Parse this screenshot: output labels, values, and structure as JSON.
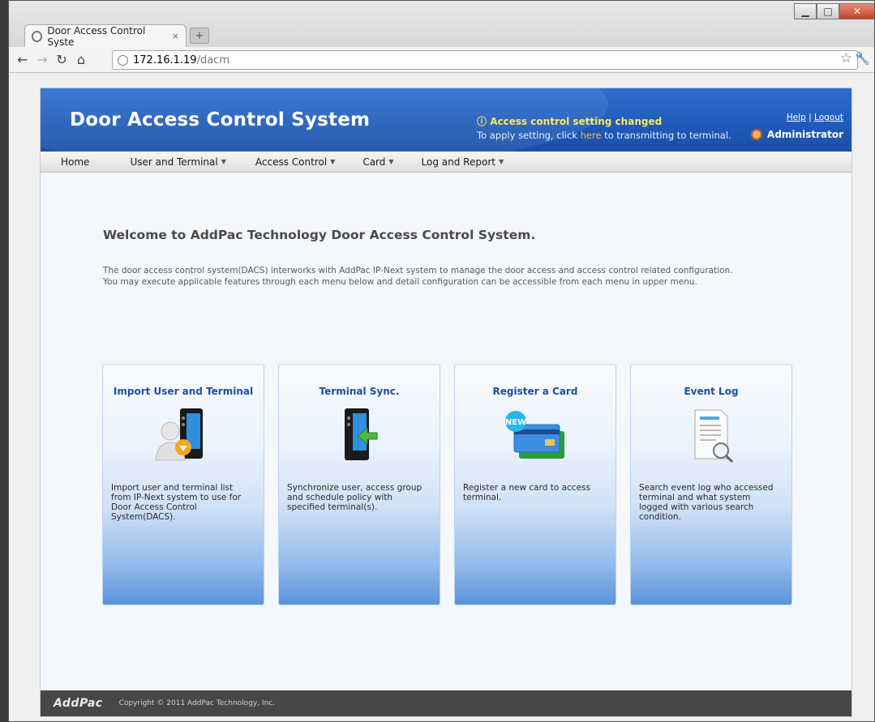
{
  "browser": {
    "tab_title": "Door Access Control Syste",
    "tab_close": "×",
    "new_tab": "+",
    "url_host": "172.16.1.19",
    "url_path": "/dacm"
  },
  "header": {
    "title": "Door Access Control System",
    "notice_title": "Access control setting changed",
    "notice_prefix": "To apply setting, click ",
    "notice_link": "here",
    "notice_suffix": " to transmitting to terminal.",
    "help": "Help",
    "separator": "|",
    "logout": "Logout",
    "user": "Administrator"
  },
  "menu": [
    "Home",
    "User and Terminal",
    "Access Control",
    "Card",
    "Log and Report"
  ],
  "main": {
    "welcome": "Welcome to AddPac Technology Door Access Control System.",
    "intro_line1": "The door access control system(DACS) interworks with AddPac IP-Next system to manage the door access and access control related configuration.",
    "intro_line2": "You may execute applicable features through each menu below and detail configuration can be accessible from each menu in upper menu."
  },
  "cards": [
    {
      "title": "Import User and Terminal",
      "icon": "import-user-icon",
      "desc": "Import user and terminal list from IP-Next system to use for Door Access Control System(DACS)."
    },
    {
      "title": "Terminal Sync.",
      "icon": "terminal-sync-icon",
      "desc": "Synchronize user, access group and schedule policy with specified terminal(s)."
    },
    {
      "title": "Register a Card",
      "icon": "register-card-icon",
      "desc": "Register a new card to access terminal."
    },
    {
      "title": "Event Log",
      "icon": "event-log-icon",
      "desc": "Search event log who accessed terminal and what system logged with various search condition."
    }
  ],
  "footer": {
    "logo": "AddPac",
    "copyright": "Copyright © 2011 AddPac Technology, Inc."
  }
}
